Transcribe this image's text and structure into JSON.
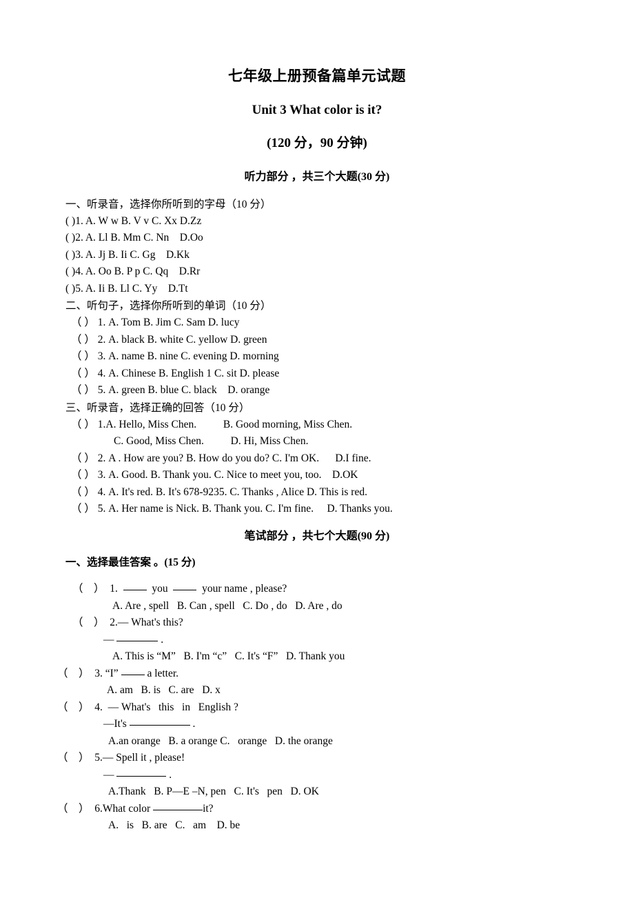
{
  "title": {
    "doc_title": "七年级上册预备篇单元试题",
    "unit_title": "Unit 3 What color is it?",
    "score_title": "(120 分，90 分钟)"
  },
  "listening": {
    "part_header": "听力部分 ，共三个大题(30 分)",
    "section1": {
      "heading": "一、听录音，选择你所听到的字母（10 分）",
      "items": [
        "( )1. A. W w B. V v C. Xx D.Zz",
        "( )2. A. Ll B. Mm C. Nn    D.Oo",
        "( )3. A. Jj B. Ii C. Gg    D.Kk",
        "( )4. A. Oo B. P p C. Qq    D.Rr",
        "( )5. A. Ii B. Ll C. Yy    D.Tt"
      ]
    },
    "section2": {
      "heading": "二、听句子，选择你所听到的单词（10 分）",
      "items": [
        "（ ） 1. A. Tom B. Jim C. Sam D. lucy",
        "（ ） 2. A. black B. white C. yellow D. green",
        "（ ） 3. A. name B. nine C. evening D. morning",
        "（ ） 4. A. Chinese B. English 1 C. sit D. please",
        "（ ） 5. A. green B. blue C. black    D. orange"
      ]
    },
    "section3": {
      "heading": "三、听录音，选择正确的回答（10 分）",
      "items": [
        "（ ） 1.A. Hello, Miss Chen.          B. Good morning, Miss Chen.",
        "C. Good, Miss Chen.          D. Hi, Miss Chen.",
        "（ ） 2. A . How are you? B. How do you do? C. I'm OK.      D.I fine.",
        "（ ） 3. A. Good. B. Thank you. C. Nice to meet you, too.    D.OK",
        "（ ） 4. A. It's red. B. It's 678-9235. C. Thanks , Alice D. This is red.",
        "（ ） 5. A. Her name is Nick. B. Thank you. C. I'm fine.     D. Thanks you."
      ]
    }
  },
  "written": {
    "part_header": "笔试部分 ，共七个大题(90 分)",
    "section1_heading": "一、选择最佳答案 。(15 分)",
    "questions": [
      {
        "marker": "（    ）  1.",
        "stem_pre": "  ",
        "stem_mid": "  you  ",
        "stem_post": "  your name , please?",
        "options": "A. Are , spell   B. Can , spell   C. Do , do   D. Are , do"
      },
      {
        "marker": "（    ）  2.",
        "stem": "— What's this?",
        "sub_answer": "—          .",
        "options": "A. This is “M”   B. I'm “c”   C. It's “F”   D. Thank you"
      },
      {
        "marker": "（    ）  3.",
        "stem_pre": " “I” ",
        "stem_post": " a letter.",
        "options": "A. am   B. is   C. are   D. x"
      },
      {
        "marker": "（    ）  4.",
        "stem": "  — What's   this   in   English ?",
        "sub_answer": "—It's                .",
        "options": "A.an orange   B. a orange C.   orange   D. the orange"
      },
      {
        "marker": "（    ）  5.",
        "stem": "— Spell it , please!",
        "sub_answer": "—              .",
        "options": "A.Thank   B. P—E –N, pen   C. It's   pen   D. OK"
      },
      {
        "marker": "（    ）  6.",
        "stem_pre": "What color ",
        "stem_post": "it?",
        "options": "A.   is   B. are   C.   am    D. be"
      }
    ]
  }
}
